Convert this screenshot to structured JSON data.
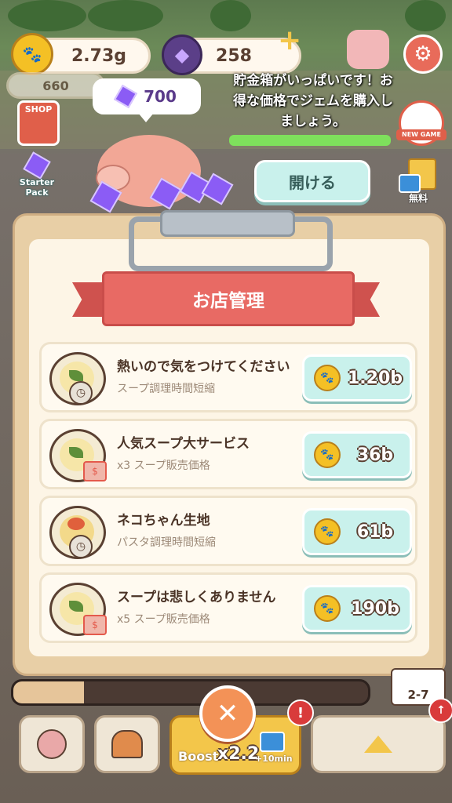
{
  "currency": {
    "coins": "2.73g",
    "gems": "258",
    "small_coins": "660"
  },
  "shop_sign": "SHOP",
  "starter_pack": "Starter Pack",
  "new_game": "NEW GAME",
  "free_label": "無料",
  "piggy": {
    "gem_amount": "700",
    "message": "貯金箱がいっぱいです！お得な価格でジェムを購入しましょう。",
    "open_button": "開ける",
    "fill_fraction": 1.0
  },
  "panel": {
    "title": "お店管理",
    "items": [
      {
        "title": "熱いので気をつけてください",
        "subtitle": "スープ調理時間短縮",
        "price": "1.20b",
        "icon": "soup-clock-icon"
      },
      {
        "title": "人気スープ大サービス",
        "subtitle": "x3 スープ販売価格",
        "price": "36b",
        "icon": "soup-tag-icon"
      },
      {
        "title": "ネコちゃん生地",
        "subtitle": "パスタ調理時間短縮",
        "price": "61b",
        "icon": "pasta-clock-icon"
      },
      {
        "title": "スープは悲しくありません",
        "subtitle": "x5 スープ販売価格",
        "price": "190b",
        "icon": "soup-tag-icon"
      }
    ]
  },
  "bottom": {
    "stage": "2-7",
    "boost_label": "Boost",
    "boost_multiplier": "x2.2",
    "boost_time": "+10min",
    "progress_fraction": 0.2
  },
  "colors": {
    "accent_mint": "#c9f1ec",
    "ribbon_red": "#e86a64",
    "coin_gold": "#f4c025",
    "gem_purple": "#8b5cf5",
    "close_orange": "#f39257"
  }
}
